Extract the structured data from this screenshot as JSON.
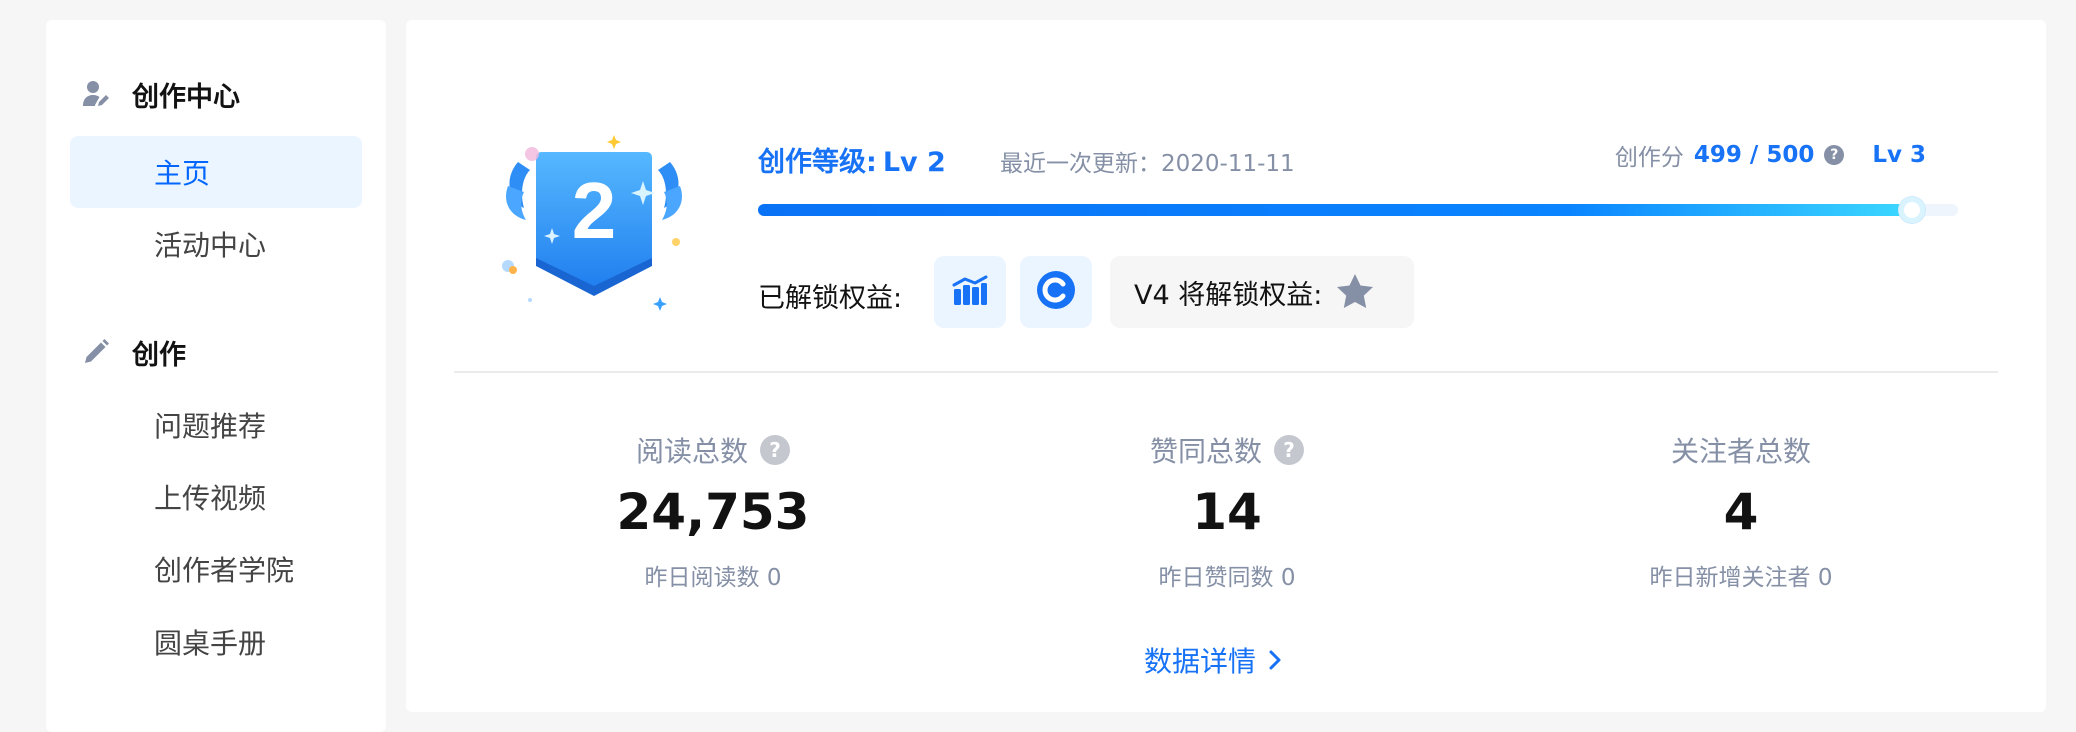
{
  "sidebar": {
    "groups": [
      {
        "title": "创作中心",
        "icon": "user-edit-icon",
        "items": [
          {
            "label": "主页",
            "active": true
          },
          {
            "label": "活动中心",
            "active": false
          }
        ]
      },
      {
        "title": "创作",
        "icon": "pencil-icon",
        "items": [
          {
            "label": "问题推荐",
            "active": false
          },
          {
            "label": "上传视频",
            "active": false
          },
          {
            "label": "创作者学院",
            "active": false
          },
          {
            "label": "圆桌手册",
            "active": false
          }
        ]
      }
    ]
  },
  "level": {
    "badge_number": "2",
    "title_label": "创作等级:",
    "current_level": "Lv 2",
    "update_text": "最近一次更新：2020-11-11",
    "score_label": "创作分",
    "score_value": "499 / 500",
    "help_glyph": "?",
    "next_level": "Lv 3",
    "progress": 0.962,
    "unlocked_label": "已解锁权益:",
    "unlocked_icons": [
      "bar-chart-icon",
      "copyright-icon"
    ],
    "locked_text": "V4 将解锁权益:",
    "locked_icon": "star-icon"
  },
  "stats": [
    {
      "label": "阅读总数",
      "has_help": true,
      "value": "24,753",
      "yesterday": "昨日阅读数 0"
    },
    {
      "label": "赞同总数",
      "has_help": true,
      "value": "14",
      "yesterday": "昨日赞同数 0"
    },
    {
      "label": "关注者总数",
      "has_help": false,
      "value": "4",
      "yesterday": "昨日新增关注者 0"
    }
  ],
  "detail_link": "数据详情",
  "colors": {
    "accent": "#1772f6",
    "active_bg": "#ebf5ff",
    "muted": "#8590a6",
    "page_bg": "#f6f6f6"
  }
}
